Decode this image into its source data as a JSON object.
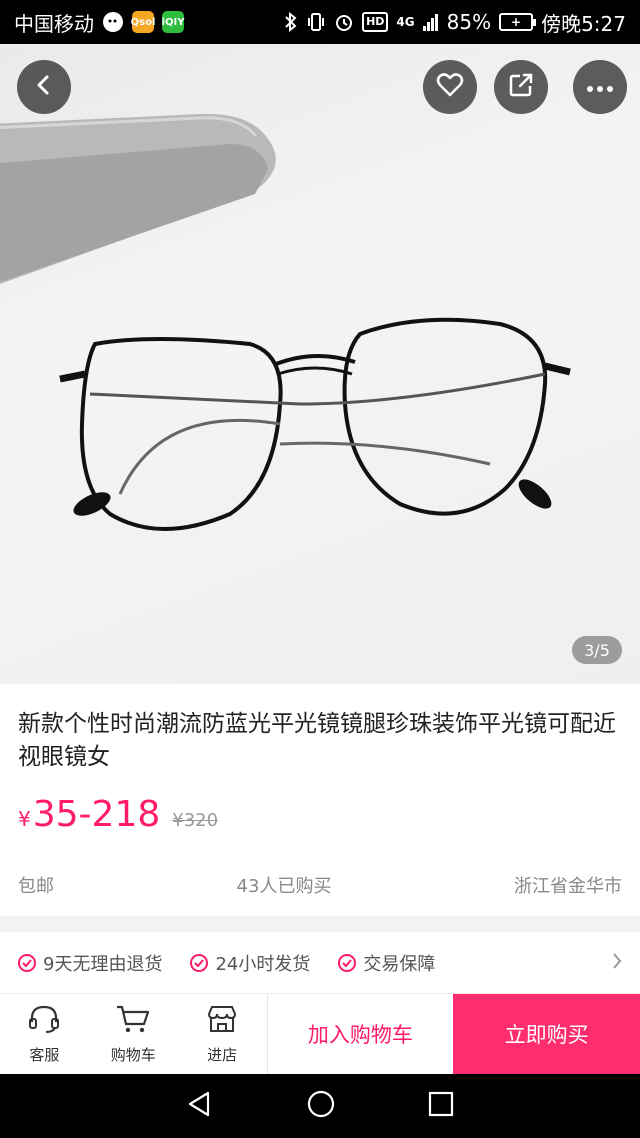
{
  "status_bar": {
    "carrier": "中国移动",
    "app1_icon": "wechat-icon",
    "app2_label": "Qsol",
    "app3_label": "iQIY",
    "hd_label": "HD",
    "network": "4G",
    "battery_percent": "85%",
    "time": "傍晚5:27"
  },
  "hero": {
    "image_counter": "3/5",
    "back_icon": "back-icon",
    "favorite_icon": "heart-icon",
    "share_icon": "share-icon",
    "more_icon": "more-icon"
  },
  "product": {
    "title": "新款个性时尚潮流防蓝光平光镜镜腿珍珠装饰平光镜可配近视眼镜女",
    "price_symbol": "¥",
    "price": "35-218",
    "original_price": "¥320",
    "shipping": "包邮",
    "sold": "43人已购买",
    "location": "浙江省金华市"
  },
  "guarantees": [
    {
      "label": "9天无理由退货"
    },
    {
      "label": "24小时发货"
    },
    {
      "label": "交易保障"
    }
  ],
  "actions": {
    "service": "客服",
    "cart": "购物车",
    "shop": "进店",
    "add_to_cart": "加入购物车",
    "buy_now": "立即购买"
  },
  "colors": {
    "accent": "#ff1a6a",
    "buy_button": "#ff2d6f"
  }
}
